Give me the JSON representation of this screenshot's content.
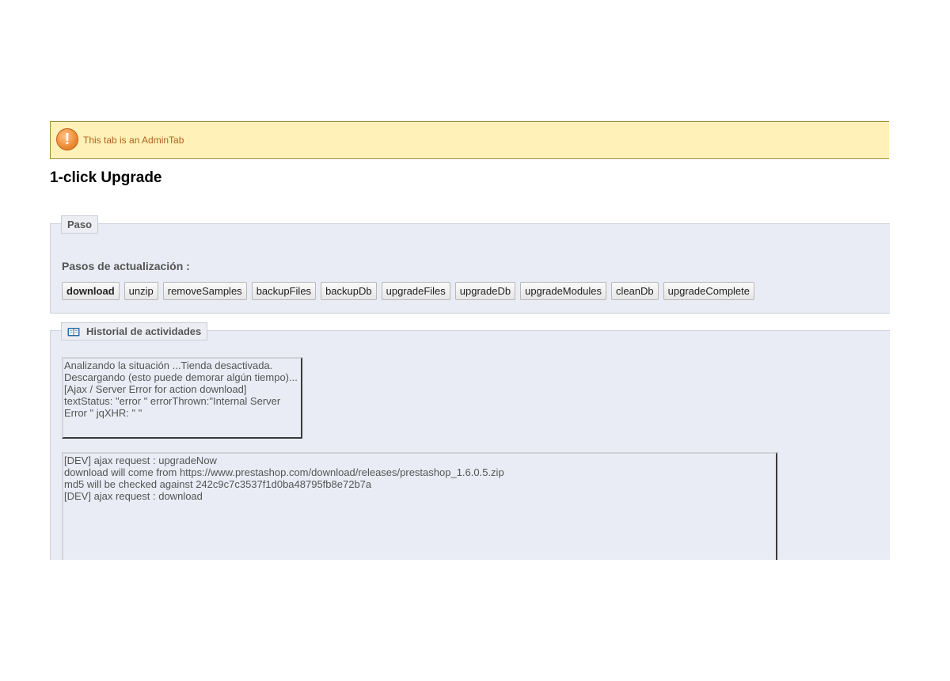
{
  "alert": {
    "icon": "warning-icon",
    "glyph": "!",
    "text": "This tab is an AdminTab"
  },
  "page": {
    "title": "1-click Upgrade"
  },
  "steps_box": {
    "legend": "Paso",
    "label": "Pasos de actualización :",
    "steps": [
      "download",
      "unzip",
      "removeSamples",
      "backupFiles",
      "backupDb",
      "upgradeFiles",
      "upgradeDb",
      "upgradeModules",
      "cleanDb",
      "upgradeComplete"
    ],
    "current_step": "download"
  },
  "history_box": {
    "legend": "Historial de actividades",
    "icon": "book-icon",
    "status_lines": [
      "Analizando la situación ...Tienda desactivada.",
      "Descargando (esto puede demorar algún tiempo)...",
      "[Ajax / Server Error for action download]",
      "textStatus: \"error \" errorThrown:\"Internal Server",
      "Error \" jqXHR: \" \""
    ],
    "debug_lines": [
      "[DEV] ajax request : upgradeNow",
      "download will come from https://www.prestashop.com/download/releases/prestashop_1.6.0.5.zip",
      "md5 will be checked against 242c9c7c3537f1d0ba48795fb8e72b7a",
      "[DEV] ajax request : download"
    ]
  },
  "colors": {
    "alert_bg": "#fff1b7",
    "alert_text": "#b0621c",
    "panel_bg": "#e9ecf4"
  }
}
